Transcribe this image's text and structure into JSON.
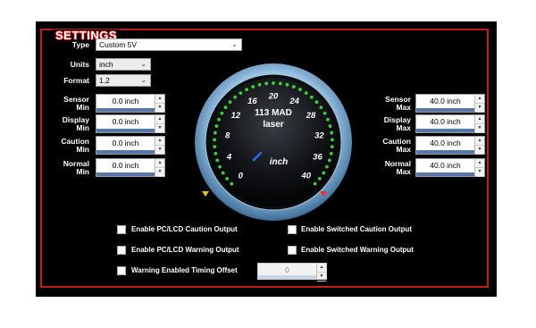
{
  "panel": {
    "title": "SETTINGS"
  },
  "type": {
    "label": "Type",
    "value": "Custom 5V"
  },
  "units": {
    "label": "Units",
    "value": "inch"
  },
  "format": {
    "label": "Format",
    "value": "1.2"
  },
  "left_fields": [
    {
      "label": "Sensor\nMin",
      "value": "0.0 inch"
    },
    {
      "label": "Display\nMin",
      "value": "0.0 inch"
    },
    {
      "label": "Caution\nMin",
      "value": "0.0 inch"
    },
    {
      "label": "Normal\nMin",
      "value": "0.0 inch"
    }
  ],
  "right_fields": [
    {
      "label": "Sensor\nMax",
      "value": "40.0 inch"
    },
    {
      "label": "Display\nMax",
      "value": "40.0 inch"
    },
    {
      "label": "Caution\nMax",
      "value": "40.0 inch"
    },
    {
      "label": "Normal\nMax",
      "value": "40.0 inch"
    }
  ],
  "gauge": {
    "title_line1": "113 MAD",
    "title_line2": "laser",
    "unit": "inch",
    "ticks": [
      "0",
      "4",
      "8",
      "12",
      "16",
      "20",
      "24",
      "28",
      "32",
      "36",
      "40"
    ],
    "min": 0,
    "max": 40,
    "value": 0,
    "dot_color": "#3ccf3a",
    "caution_marker_color": "#e6c21a",
    "warning_marker_color": "#e23838"
  },
  "options": {
    "pc_lcd_caution": "Enable PC/LCD Caution Output",
    "pc_lcd_warning": "Enable PC/LCD Warning Output",
    "switched_caution": "Enable Switched Caution Output",
    "switched_warning": "Enable Switched Warning Output",
    "timing_offset": "Warning Enabled Timing Offset",
    "timing_offset_value": "0"
  }
}
